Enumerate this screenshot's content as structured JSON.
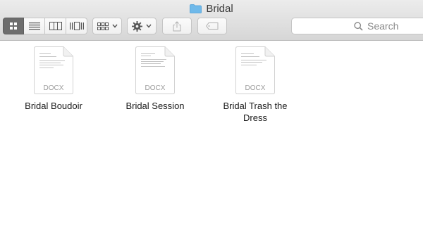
{
  "window": {
    "title": "Bridal"
  },
  "toolbar": {
    "view_buttons": [
      "icon-view",
      "list-view",
      "column-view",
      "cover-flow-view"
    ],
    "active_view": "icon-view",
    "group_icon": "grid-icon",
    "action_icon": "gear-icon",
    "share_icon": "share-icon",
    "tag_icon": "tag-icon"
  },
  "search": {
    "placeholder": "Search"
  },
  "files": [
    {
      "type_label": "DOCX",
      "name_line1": "Bridal Boudoir",
      "name_line2": ""
    },
    {
      "type_label": "DOCX",
      "name_line1": "Bridal Session",
      "name_line2": ""
    },
    {
      "type_label": "DOCX",
      "name_line1": "Bridal Trash the",
      "name_line2": "Dress"
    }
  ],
  "colors": {
    "folder_blue": "#6fb9ea",
    "active_segment": "#6d6d6d"
  }
}
